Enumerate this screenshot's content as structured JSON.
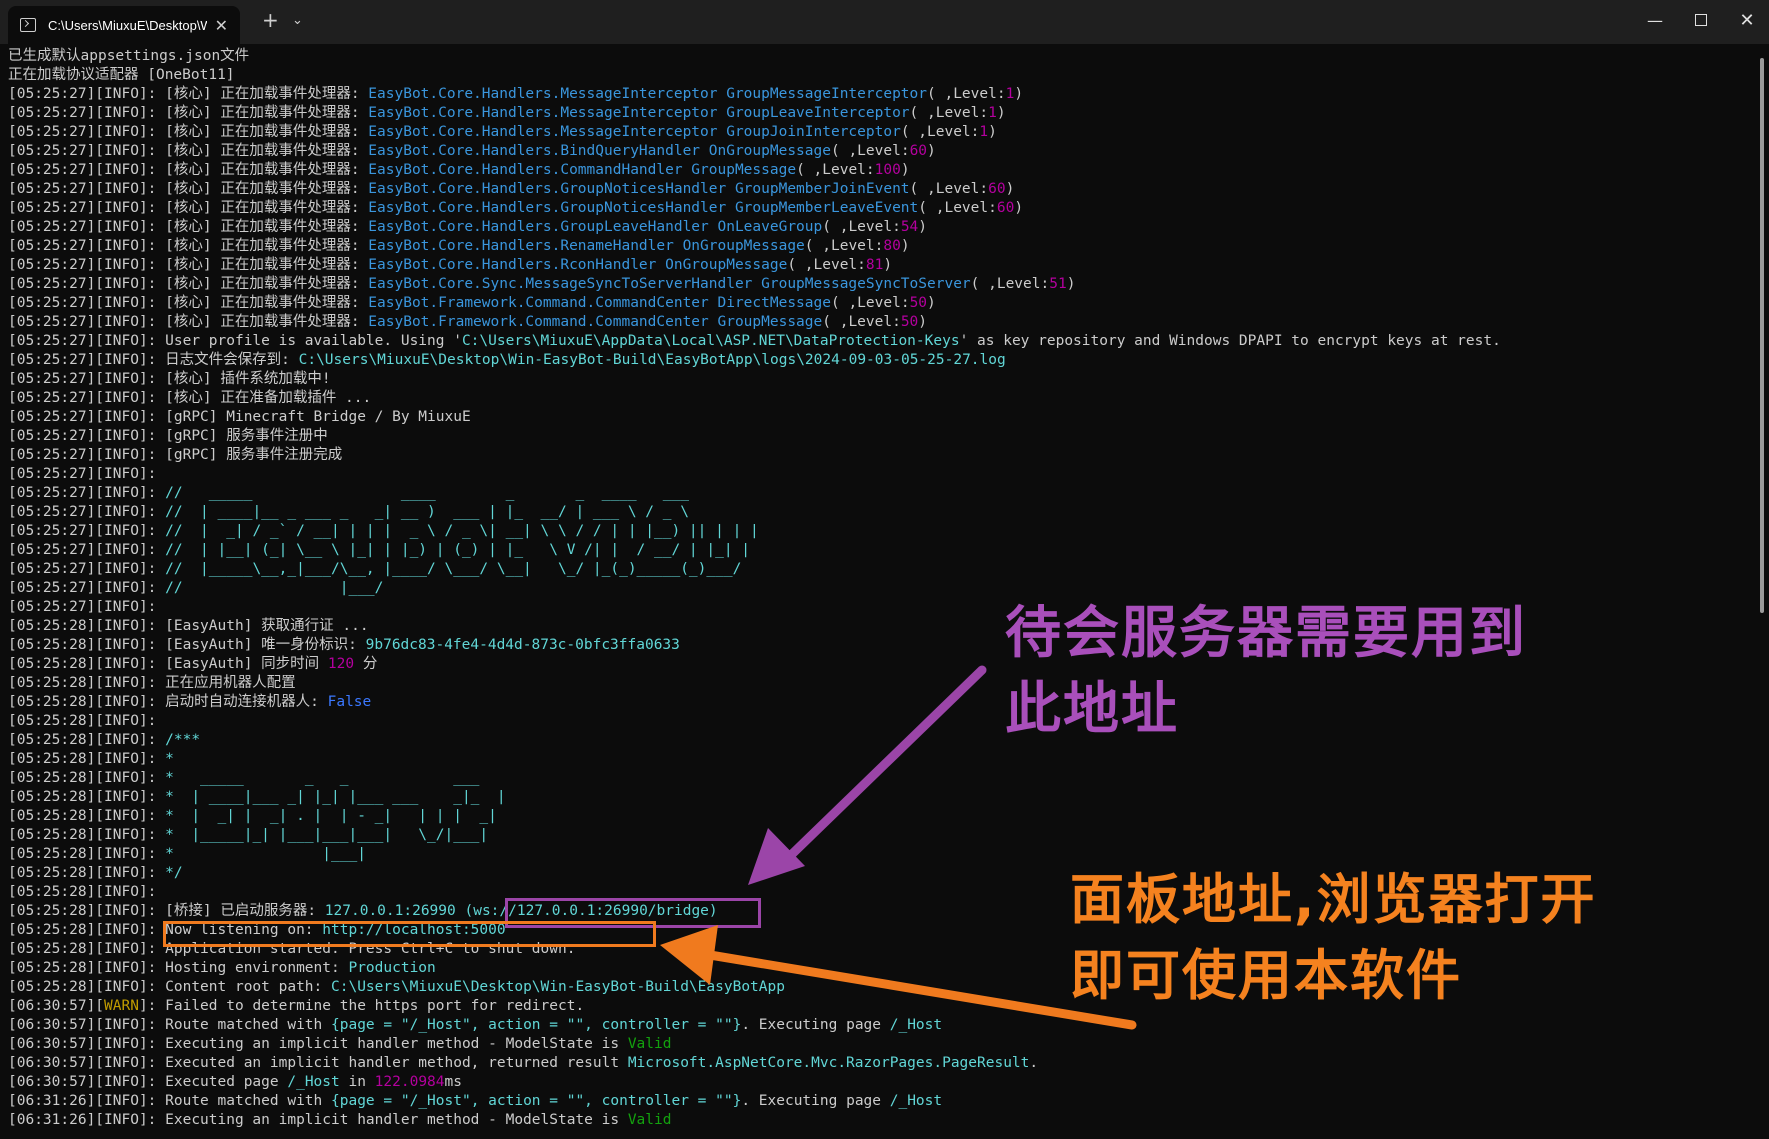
{
  "window": {
    "tab_title": "C:\\Users\\MiuxuE\\Desktop\\Win-EasyBot-Build\\EasyBotApp\\EasyBot.exe",
    "tab_close": "✕",
    "new_tab": "+",
    "tab_dropdown": "⌄",
    "minimize": "—",
    "close": "✕"
  },
  "console": {
    "lines": [
      [
        [
          "w",
          "已生成默认appsettings.json文件"
        ]
      ],
      [
        [
          "w",
          "正在加载协议适配器 [OneBot11]"
        ]
      ],
      [
        [
          "w",
          "[05:25:27][INFO]: [核心] 正在加载事件处理器: "
        ],
        [
          "t",
          "EasyBot.Core.Handlers.MessageInterceptor GroupMessageInterceptor"
        ],
        [
          "w",
          "( ,Level:"
        ],
        [
          "m",
          "1"
        ],
        [
          "w",
          ")"
        ]
      ],
      [
        [
          "w",
          "[05:25:27][INFO]: [核心] 正在加载事件处理器: "
        ],
        [
          "t",
          "EasyBot.Core.Handlers.MessageInterceptor GroupLeaveInterceptor"
        ],
        [
          "w",
          "( ,Level:"
        ],
        [
          "m",
          "1"
        ],
        [
          "w",
          ")"
        ]
      ],
      [
        [
          "w",
          "[05:25:27][INFO]: [核心] 正在加载事件处理器: "
        ],
        [
          "t",
          "EasyBot.Core.Handlers.MessageInterceptor GroupJoinInterceptor"
        ],
        [
          "w",
          "( ,Level:"
        ],
        [
          "m",
          "1"
        ],
        [
          "w",
          ")"
        ]
      ],
      [
        [
          "w",
          "[05:25:27][INFO]: [核心] 正在加载事件处理器: "
        ],
        [
          "t",
          "EasyBot.Core.Handlers.BindQueryHandler OnGroupMessage"
        ],
        [
          "w",
          "( ,Level:"
        ],
        [
          "m",
          "60"
        ],
        [
          "w",
          ")"
        ]
      ],
      [
        [
          "w",
          "[05:25:27][INFO]: [核心] 正在加载事件处理器: "
        ],
        [
          "t",
          "EasyBot.Core.Handlers.CommandHandler GroupMessage"
        ],
        [
          "w",
          "( ,Level:"
        ],
        [
          "m",
          "100"
        ],
        [
          "w",
          ")"
        ]
      ],
      [
        [
          "w",
          "[05:25:27][INFO]: [核心] 正在加载事件处理器: "
        ],
        [
          "t",
          "EasyBot.Core.Handlers.GroupNoticesHandler GroupMemberJoinEvent"
        ],
        [
          "w",
          "( ,Level:"
        ],
        [
          "m",
          "60"
        ],
        [
          "w",
          ")"
        ]
      ],
      [
        [
          "w",
          "[05:25:27][INFO]: [核心] 正在加载事件处理器: "
        ],
        [
          "t",
          "EasyBot.Core.Handlers.GroupNoticesHandler GroupMemberLeaveEvent"
        ],
        [
          "w",
          "( ,Level:"
        ],
        [
          "m",
          "60"
        ],
        [
          "w",
          ")"
        ]
      ],
      [
        [
          "w",
          "[05:25:27][INFO]: [核心] 正在加载事件处理器: "
        ],
        [
          "t",
          "EasyBot.Core.Handlers.GroupLeaveHandler OnLeaveGroup"
        ],
        [
          "w",
          "( ,Level:"
        ],
        [
          "m",
          "54"
        ],
        [
          "w",
          ")"
        ]
      ],
      [
        [
          "w",
          "[05:25:27][INFO]: [核心] 正在加载事件处理器: "
        ],
        [
          "t",
          "EasyBot.Core.Handlers.RenameHandler OnGroupMessage"
        ],
        [
          "w",
          "( ,Level:"
        ],
        [
          "m",
          "80"
        ],
        [
          "w",
          ")"
        ]
      ],
      [
        [
          "w",
          "[05:25:27][INFO]: [核心] 正在加载事件处理器: "
        ],
        [
          "t",
          "EasyBot.Core.Handlers.RconHandler OnGroupMessage"
        ],
        [
          "w",
          "( ,Level:"
        ],
        [
          "m",
          "81"
        ],
        [
          "w",
          ")"
        ]
      ],
      [
        [
          "w",
          "[05:25:27][INFO]: [核心] 正在加载事件处理器: "
        ],
        [
          "t",
          "EasyBot.Core.Sync.MessageSyncToServerHandler GroupMessageSyncToServer"
        ],
        [
          "w",
          "( ,Level:"
        ],
        [
          "m",
          "51"
        ],
        [
          "w",
          ")"
        ]
      ],
      [
        [
          "w",
          "[05:25:27][INFO]: [核心] 正在加载事件处理器: "
        ],
        [
          "t",
          "EasyBot.Framework.Command.CommandCenter DirectMessage"
        ],
        [
          "w",
          "( ,Level:"
        ],
        [
          "m",
          "50"
        ],
        [
          "w",
          ")"
        ]
      ],
      [
        [
          "w",
          "[05:25:27][INFO]: [核心] 正在加载事件处理器: "
        ],
        [
          "t",
          "EasyBot.Framework.Command.CommandCenter GroupMessage"
        ],
        [
          "w",
          "( ,Level:"
        ],
        [
          "m",
          "50"
        ],
        [
          "w",
          ")"
        ]
      ],
      [
        [
          "w",
          "[05:25:27][INFO]: User profile is available. Using '"
        ],
        [
          "c",
          "C:\\Users\\MiuxuE\\AppData\\Local\\ASP.NET\\DataProtection-Keys"
        ],
        [
          "w",
          "' as key repository and Windows DPAPI to encrypt keys at rest."
        ]
      ],
      [
        [
          "w",
          "[05:25:27][INFO]: 日志文件会保存到: "
        ],
        [
          "c",
          "C:\\Users\\MiuxuE\\Desktop\\Win-EasyBot-Build\\EasyBotApp\\logs\\2024-09-03-05-25-27.log"
        ]
      ],
      [
        [
          "w",
          "[05:25:27][INFO]: [核心] 插件系统加载中!"
        ]
      ],
      [
        [
          "w",
          "[05:25:27][INFO]: [核心] 正在准备加载插件 ..."
        ]
      ],
      [
        [
          "w",
          "[05:25:27][INFO]: [gRPC] Minecraft Bridge / By MiuxuE"
        ]
      ],
      [
        [
          "w",
          "[05:25:27][INFO]: [gRPC] 服务事件注册中"
        ]
      ],
      [
        [
          "w",
          "[05:25:27][INFO]: [gRPC] 服务事件注册完成"
        ]
      ],
      [
        [
          "w",
          "[05:25:27][INFO]: "
        ]
      ],
      [
        [
          "w",
          "[05:25:27][INFO]: "
        ],
        [
          "art",
          "//   _____                 ____        _       _  ____   ___"
        ]
      ],
      [
        [
          "w",
          "[05:25:27][INFO]: "
        ],
        [
          "art",
          "//  | ____|__ _ ___ _   _| __ )  ___ | |_  __/ | ___ \\ / _ \\"
        ]
      ],
      [
        [
          "w",
          "[05:25:27][INFO]: "
        ],
        [
          "art",
          "//  |  _| / _` / __| | | |  _ \\ / _ \\| __| \\ \\ / / | | |__) || | | |"
        ]
      ],
      [
        [
          "w",
          "[05:25:27][INFO]: "
        ],
        [
          "art",
          "//  | |__| (_| \\__ \\ |_| | |_) | (_) | |_   \\ V /| |  / __/ | |_| |"
        ]
      ],
      [
        [
          "w",
          "[05:25:27][INFO]: "
        ],
        [
          "art",
          "//  |_____\\__,_|___/\\__, |____/ \\___/ \\__|   \\_/ |_(_)_____(_)___/"
        ]
      ],
      [
        [
          "w",
          "[05:25:27][INFO]: "
        ],
        [
          "art",
          "//                  |___/"
        ]
      ],
      [
        [
          "w",
          "[05:25:27][INFO]: "
        ]
      ],
      [
        [
          "w",
          "[05:25:28][INFO]: [EasyAuth] 获取通行证 ..."
        ]
      ],
      [
        [
          "w",
          "[05:25:28][INFO]: [EasyAuth] 唯一身份标识: "
        ],
        [
          "c",
          "9b76dc83-4fe4-4d4d-873c-0bfc3ffa0633"
        ]
      ],
      [
        [
          "w",
          "[05:25:28][INFO]: [EasyAuth] 同步时间 "
        ],
        [
          "m",
          "120"
        ],
        [
          "w",
          " 分"
        ]
      ],
      [
        [
          "w",
          "[05:25:28][INFO]: 正在应用机器人配置"
        ]
      ],
      [
        [
          "w",
          "[05:25:28][INFO]: 启动时自动连接机器人: "
        ],
        [
          "b",
          "False"
        ]
      ],
      [
        [
          "w",
          "[05:25:28][INFO]: "
        ]
      ],
      [
        [
          "w",
          "[05:25:28][INFO]: "
        ],
        [
          "art",
          "/***"
        ]
      ],
      [
        [
          "w",
          "[05:25:28][INFO]: "
        ],
        [
          "art",
          "*"
        ]
      ],
      [
        [
          "w",
          "[05:25:28][INFO]: "
        ],
        [
          "art",
          "*   _____       _   _            ___"
        ]
      ],
      [
        [
          "w",
          "[05:25:28][INFO]: "
        ],
        [
          "art",
          "*  | ____|___ _| |_| |___ ___    _|_  |"
        ]
      ],
      [
        [
          "w",
          "[05:25:28][INFO]: "
        ],
        [
          "art",
          "*  |  _| |  _| . |  | - _|   | | |  _|"
        ]
      ],
      [
        [
          "w",
          "[05:25:28][INFO]: "
        ],
        [
          "art",
          "*  |_____|_| |___|___|___|   \\_/|___|"
        ]
      ],
      [
        [
          "w",
          "[05:25:28][INFO]: "
        ],
        [
          "art",
          "*                 |___|"
        ]
      ],
      [
        [
          "w",
          "[05:25:28][INFO]: "
        ],
        [
          "art",
          "*/"
        ]
      ],
      [
        [
          "w",
          "[05:25:28][INFO]: "
        ]
      ],
      [
        [
          "w",
          "[05:25:28][INFO]: [桥接] 已启动服务器: "
        ],
        [
          "c",
          "127.0.0.1:26990"
        ],
        [
          "w",
          " "
        ],
        [
          "c",
          "(ws://127.0.0.1:26990/bridge)"
        ]
      ],
      [
        [
          "w",
          "[05:25:28][INFO]: Now listening on: "
        ],
        [
          "c",
          "http://localhost:5000"
        ]
      ],
      [
        [
          "w",
          "[05:25:28][INFO]: Application started. Press Ctrl+C to shut down."
        ]
      ],
      [
        [
          "w",
          "[05:25:28][INFO]: Hosting environment: "
        ],
        [
          "c",
          "Production"
        ]
      ],
      [
        [
          "w",
          "[05:25:28][INFO]: Content root path: "
        ],
        [
          "c",
          "C:\\Users\\MiuxuE\\Desktop\\Win-EasyBot-Build\\EasyBotApp"
        ]
      ],
      [
        [
          "w",
          "[06:30:57]["
        ],
        [
          "y",
          "WARN"
        ],
        [
          "w",
          "]: Failed to determine the https port for redirect."
        ]
      ],
      [
        [
          "w",
          "[06:30:57][INFO]: Route matched with "
        ],
        [
          "c",
          "{page = \"/_Host\", action = \"\", controller = \"\"}"
        ],
        [
          "w",
          ". Executing page "
        ],
        [
          "c",
          "/_Host"
        ]
      ],
      [
        [
          "w",
          "[06:30:57][INFO]: Executing an implicit handler method - ModelState is "
        ],
        [
          "g",
          "Valid"
        ]
      ],
      [
        [
          "w",
          "[06:30:57][INFO]: Executed an implicit handler method, returned result "
        ],
        [
          "c",
          "Microsoft.AspNetCore.Mvc.RazorPages.PageResult"
        ],
        [
          "w",
          "."
        ]
      ],
      [
        [
          "w",
          "[06:30:57][INFO]: Executed page "
        ],
        [
          "c",
          "/_Host"
        ],
        [
          "w",
          " in "
        ],
        [
          "m",
          "122.0984"
        ],
        [
          "w",
          "ms"
        ]
      ],
      [
        [
          "w",
          "[06:31:26][INFO]: Route matched with "
        ],
        [
          "c",
          "{page = \"/_Host\", action = \"\", controller = \"\"}"
        ],
        [
          "w",
          ". Executing page "
        ],
        [
          "c",
          "/_Host"
        ]
      ],
      [
        [
          "w",
          "[06:31:26][INFO]: Executing an implicit handler method - ModelState is "
        ],
        [
          "g",
          "Valid"
        ]
      ]
    ]
  },
  "annotations": {
    "purple_line1": "待会服务器需要用到",
    "purple_line2": "此地址",
    "orange_line1": "面板地址,浏览器打开",
    "orange_line2": "即可使用本软件"
  },
  "colors": {
    "background": "#0c0c0c",
    "text": "#cccccc",
    "type_names": "#3a96dd",
    "strings": "#61d6d6",
    "numbers": "#b4009e",
    "warn": "#c19c00",
    "valid": "#13a10e",
    "annotation_purple": "#a94fbb",
    "annotation_orange": "#f5821f"
  }
}
